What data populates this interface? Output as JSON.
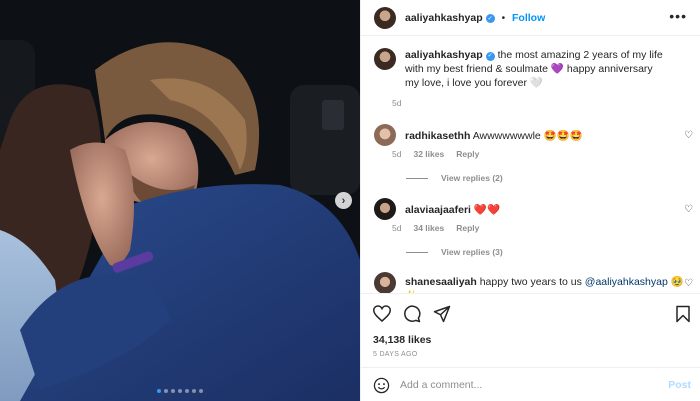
{
  "post": {
    "author": "aaliyahkashyap",
    "follow_label": "Follow",
    "dot_separator": "•",
    "more_label": "•••",
    "next_arrow": "›",
    "carousel": {
      "total": 7,
      "active_index": 0
    }
  },
  "caption": {
    "username": "aaliyahkashyap",
    "text": "the most amazing 2 years of my life with my best friend & soulmate 💜 happy anniversary my love, i love you forever 🤍",
    "age": "5d"
  },
  "comments": [
    {
      "username": "radhikasethh",
      "text": "Awwwwwwwle 🤩🤩🤩",
      "age": "5d",
      "likes": "32 likes",
      "reply_label": "Reply",
      "view_replies": "View replies (2)"
    },
    {
      "username": "alaviaajaaferi",
      "text": "❤️❤️",
      "age": "5d",
      "likes": "34 likes",
      "reply_label": "Reply",
      "view_replies": "View replies (3)"
    },
    {
      "username": "shanesaaliyah",
      "text": "happy two years to us ",
      "mention": "@aaliyahkashyap",
      "suffix": " 🥹✨"
    }
  ],
  "footer": {
    "likes": "34,138 likes",
    "time_ago": "5 DAYS AGO",
    "add_comment_placeholder": "Add a comment...",
    "post_label": "Post"
  },
  "icons": {
    "like": "heart-icon",
    "comment": "comment-icon",
    "share": "share-icon",
    "save": "bookmark-icon",
    "smile": "emoji-icon",
    "next": "chevron-right-icon"
  },
  "colors": {
    "accent": "#0095f6",
    "verified": "#3897f0",
    "muted": "#8e8e8e",
    "post_disabled": "#b3dbff"
  }
}
